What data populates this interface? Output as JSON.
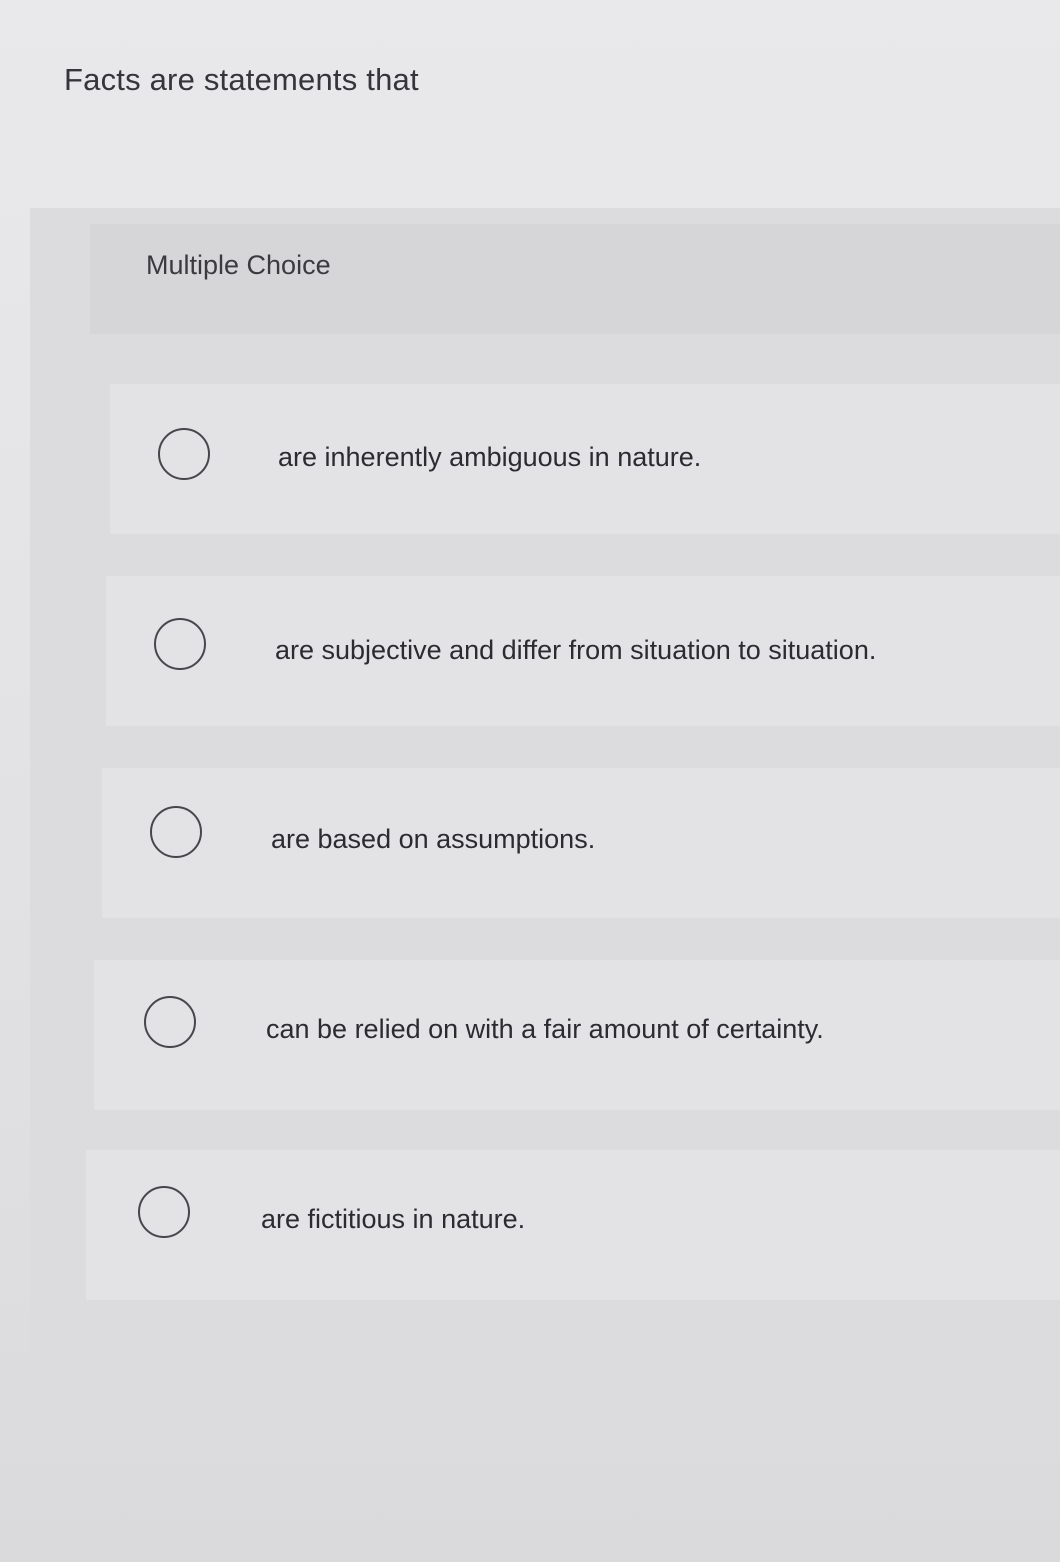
{
  "question": {
    "stem": "Facts are statements that",
    "type_label": "Multiple Choice"
  },
  "choices": [
    {
      "label": "are inherently ambiguous in nature.",
      "selected": false
    },
    {
      "label": "are subjective and differ from situation to situation.",
      "selected": false
    },
    {
      "label": "are based on assumptions.",
      "selected": false
    },
    {
      "label": "can be relied on with a fair amount of certainty.",
      "selected": false
    },
    {
      "label": "are fictitious in nature.",
      "selected": false
    }
  ]
}
